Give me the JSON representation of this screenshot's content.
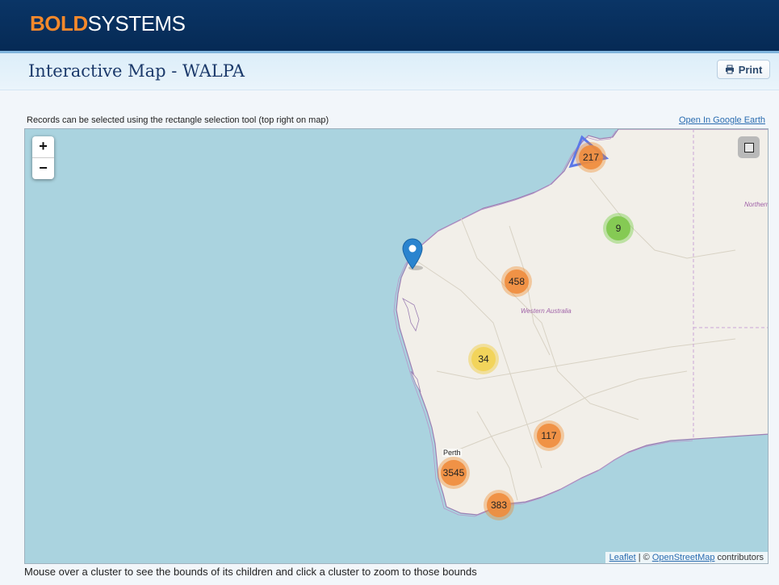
{
  "header": {
    "logo_bold": "BOLD",
    "logo_rest": "SYSTEMS",
    "logo_colors": {
      "bold": "#f5892b",
      "rest": "#ffffff",
      "bar": "#062a55"
    }
  },
  "page": {
    "title": "Interactive Map - WALPA",
    "print_label": "Print",
    "hint": "Records can be selected using the rectangle selection tool (top right on map)",
    "google_earth_link": "Open In Google Earth",
    "footer_note": "Mouse over a cluster to see the bounds of its children and click a cluster to zoom to those bounds"
  },
  "map": {
    "zoom_in": "+",
    "zoom_out": "−",
    "region_label": "Western Australia",
    "territory_label": "Northern",
    "city_label": "Perth",
    "clusters": [
      {
        "count": "217",
        "color": "orange"
      },
      {
        "count": "9",
        "color": "green"
      },
      {
        "count": "458",
        "color": "orange"
      },
      {
        "count": "34",
        "color": "yellow"
      },
      {
        "count": "117",
        "color": "orange"
      },
      {
        "count": "3545",
        "color": "orange"
      },
      {
        "count": "383",
        "color": "orange"
      }
    ],
    "attribution": {
      "leaflet": "Leaflet",
      "sep": " | © ",
      "osm": "OpenStreetMap",
      "suffix": " contributors"
    },
    "icons": [
      "print-icon",
      "map-pin-icon",
      "rectangle-select-icon"
    ]
  }
}
